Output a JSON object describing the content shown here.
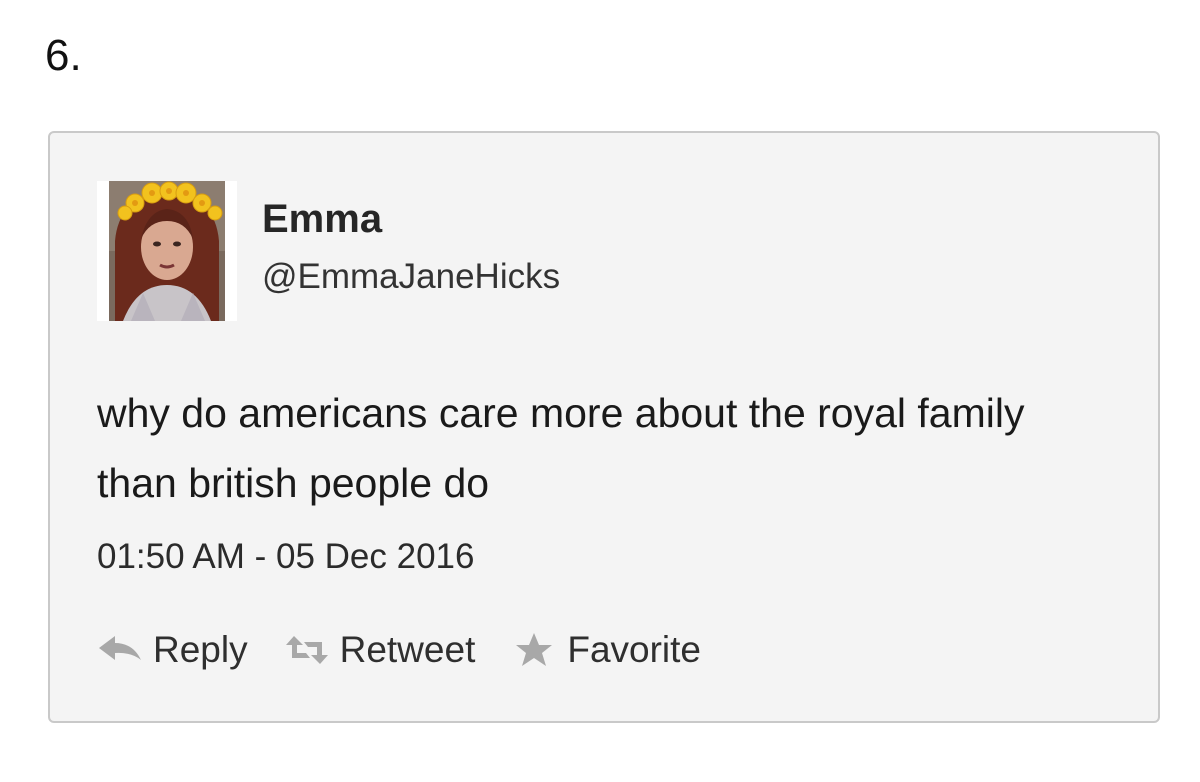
{
  "page": {
    "item_number": "6."
  },
  "tweet": {
    "author": {
      "display_name": "Emma",
      "handle": "@EmmaJaneHicks",
      "avatar_alt": "Emma"
    },
    "text": "why do americans care more about the royal family than british people do",
    "timestamp": "01:50 AM - 05 Dec 2016",
    "actions": {
      "reply": {
        "label": "Reply",
        "icon": "reply-icon"
      },
      "retweet": {
        "label": "Retweet",
        "icon": "retweet-icon"
      },
      "favorite": {
        "label": "Favorite",
        "icon": "star-icon"
      }
    }
  },
  "colors": {
    "card_background": "#f4f4f4",
    "card_border": "#c9c9c9",
    "icon_gray": "#a8a8a8",
    "text": "#222222"
  }
}
